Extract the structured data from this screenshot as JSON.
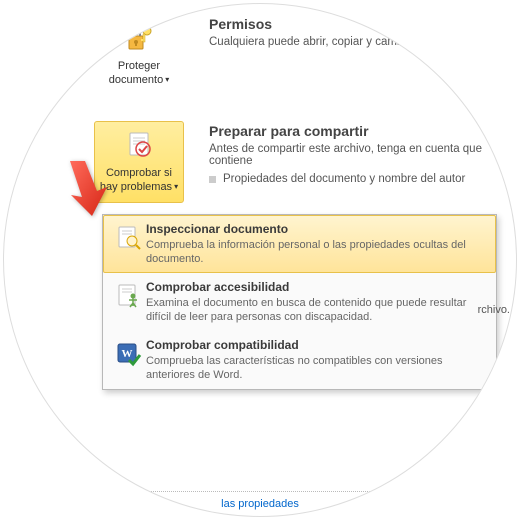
{
  "permisos": {
    "title": "Permisos",
    "sub": "Cualquiera puede abrir, copiar y cambiar",
    "btn": "Proteger documento",
    "btn_l1": "Proteger",
    "btn_l2": "documento"
  },
  "preparar": {
    "title": "Preparar para compartir",
    "sub": "Antes de compartir este archivo, tenga en cuenta que contiene",
    "bullet1": "Propiedades del documento y nombre del autor",
    "btn_l1": "Comprobar si",
    "btn_l2": "hay problemas"
  },
  "menu": {
    "inspect": {
      "title": "Inspeccionar documento",
      "desc": "Comprueba la información personal o las propiedades ocultas del documento."
    },
    "access": {
      "title": "Comprobar accesibilidad",
      "desc": "Examina el documento en busca de contenido que puede resultar difícil de leer para personas con discapacidad."
    },
    "compat": {
      "title": "Comprobar compatibilidad",
      "desc": "Comprueba las características no compatibles con versiones anteriores de Word."
    }
  },
  "side_note": "rchivo.",
  "footer": "las propiedades"
}
